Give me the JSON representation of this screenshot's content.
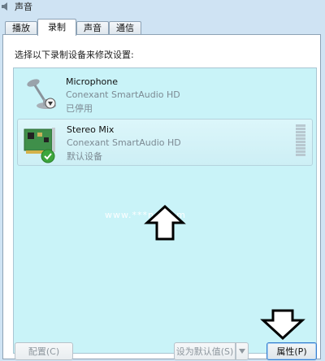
{
  "window": {
    "title": "声音"
  },
  "tabs": [
    {
      "label": "播放",
      "active": false
    },
    {
      "label": "录制",
      "active": true
    },
    {
      "label": "声音",
      "active": false
    },
    {
      "label": "通信",
      "active": false
    }
  ],
  "panel": {
    "instruction": "选择以下录制设备来修改设置:",
    "devices": [
      {
        "name": "Microphone",
        "driver": "Conexant SmartAudio HD",
        "status": "已停用",
        "icon": "microphone-icon",
        "badge": "disabled-arrow-badge"
      },
      {
        "name": "Stereo Mix",
        "driver": "Conexant SmartAudio HD",
        "status": "默认设备",
        "icon": "sound-card-icon",
        "badge": "default-check-badge",
        "selected": true
      }
    ],
    "watermark": "www.***ng.com"
  },
  "buttons": {
    "configure": "配置(C)",
    "set_default": "设为默认值(S)",
    "properties": "属性(P)"
  }
}
